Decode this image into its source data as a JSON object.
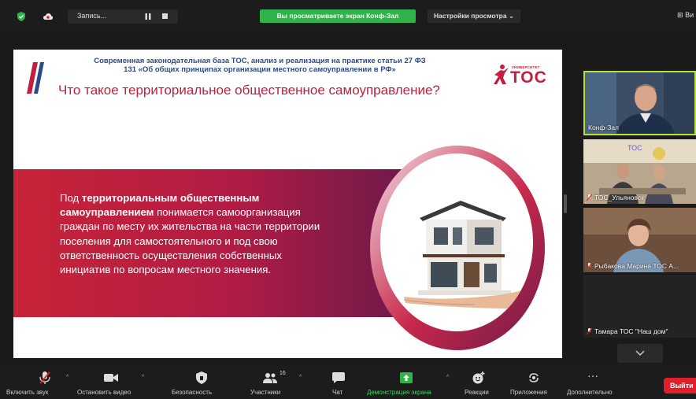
{
  "topbar": {
    "recording_label": "Запись...",
    "share_banner": "Вы просматриваете экран Конф-Зал",
    "view_settings": "Настройки просмотра ⌄",
    "grid_label": "Ви"
  },
  "slide": {
    "header_line1": "Современная законодательная база ТОС, анализ и реализация на практике статьи 27 ФЗ",
    "header_line2": "131 «Об общих принципах организации местного самоуправлении в РФ»",
    "title": "Что такое территориальное общественное самоуправление?",
    "logo_small_text": "УНИВЕРСИТЕТ",
    "logo_text": "ТОС",
    "body_prefix": "Под ",
    "body_bold": "территориальным общественным самоуправлением",
    "body_rest": " понимается самоорганизация граждан по месту их жительства на части территории поселения для самостоятельного и под свою ответственность осуществления собственных инициатив по вопросам местного значения."
  },
  "participants": [
    {
      "name": "Конф-Зал"
    },
    {
      "name": "ТОС_Ульяновск"
    },
    {
      "name": "Рыбакова Марина ТОС А..."
    },
    {
      "name": "Тамара ТОС \"Наш дом\""
    }
  ],
  "toolbar": {
    "unmute": "Включить звук",
    "start_video": "Остановить видео",
    "security": "Безопасность",
    "participants": "Участники",
    "participants_count": "16",
    "chat": "Чат",
    "share_screen": "Демонстрация экрана",
    "reactions": "Реакции",
    "apps": "Приложения",
    "more": "Дополнительно",
    "leave": "Выйти"
  },
  "colors": {
    "share_green": "#2fb34a",
    "slide_red": "#c0203e",
    "slide_blue": "#2b4a8a",
    "active_speaker_border": "#b6e33b",
    "leave_red": "#e01f2a"
  }
}
